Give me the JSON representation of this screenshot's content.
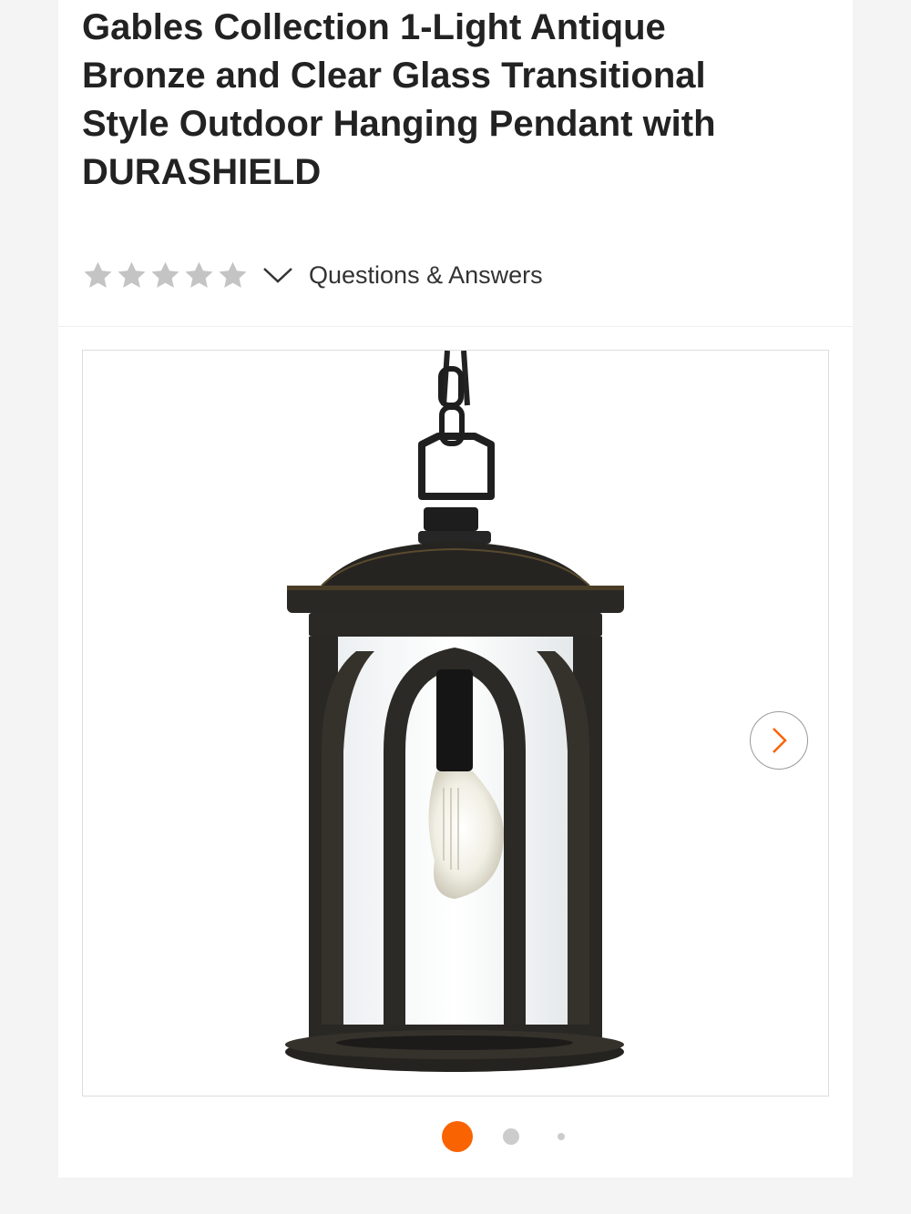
{
  "product": {
    "title": "Gables Collection 1-Light Antique Bronze and Clear Glass Transitional Style Outdoor Hanging Pendant with DURASHIELD"
  },
  "rating": {
    "stars_filled": 0,
    "stars_total": 5,
    "expand_icon": "chevron-down-icon",
    "qa_label": "Questions & Answers"
  },
  "gallery": {
    "image_subject": "outdoor-hanging-lantern-pendant",
    "next_icon": "chevron-right-icon",
    "slide_count": 3,
    "active_slide": 1
  },
  "colors": {
    "accent": "#f96302",
    "star_empty": "#c4c4c4",
    "dot_inactive": "#cccccc",
    "text_primary": "#222222"
  }
}
